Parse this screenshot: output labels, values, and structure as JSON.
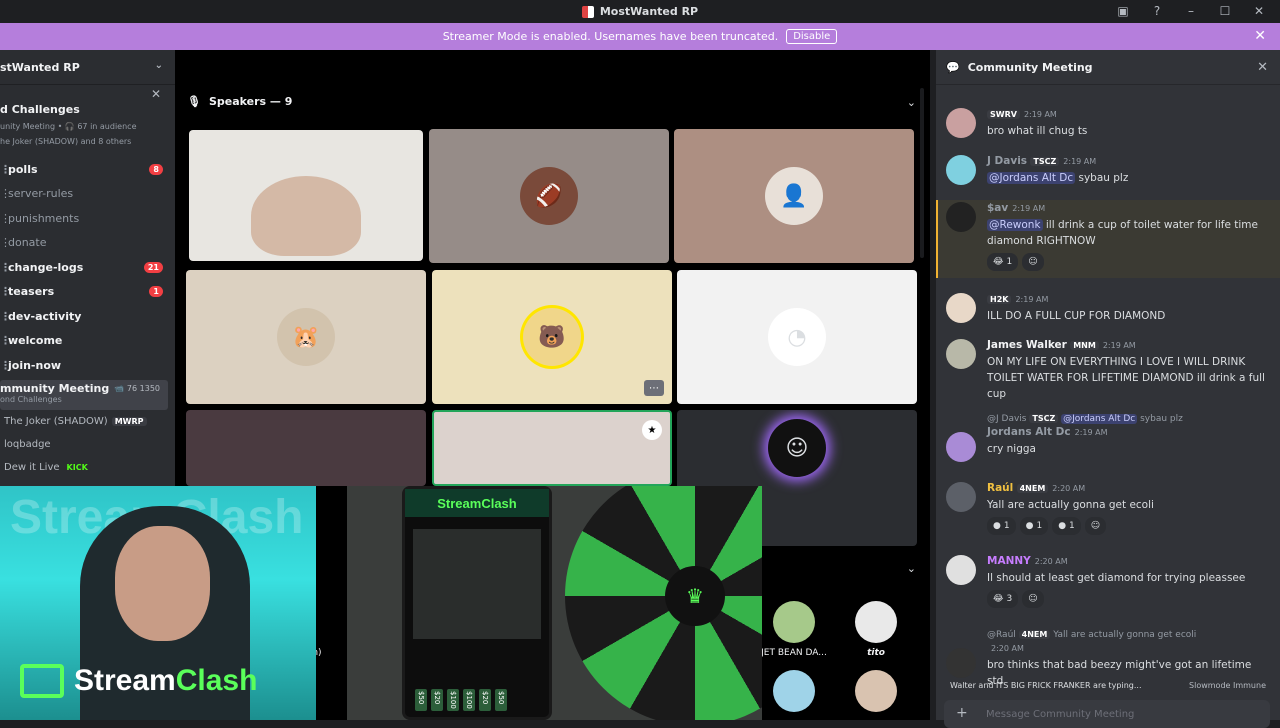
{
  "app": {
    "title": "MostWanted RP"
  },
  "banner": {
    "text": "Streamer Mode is enabled. Usernames have been truncated.",
    "button": "Disable"
  },
  "sidebar": {
    "server_name": "stWanted RP",
    "event": {
      "title": "d Challenges",
      "line1": "unity Meeting • 🎧 67 in audience",
      "line2": "he Joker (SHADOW) and 8 others"
    },
    "channels": [
      {
        "name": "polls",
        "bold": true,
        "badge": "8"
      },
      {
        "name": "server-rules",
        "bold": false,
        "badge": ""
      },
      {
        "name": "punishments",
        "bold": false,
        "badge": ""
      },
      {
        "name": "donate",
        "bold": false,
        "badge": ""
      },
      {
        "name": "change-logs",
        "bold": true,
        "badge": "21"
      },
      {
        "name": "teasers",
        "bold": true,
        "badge": "1"
      },
      {
        "name": "dev-activity",
        "bold": true,
        "badge": ""
      },
      {
        "name": "welcome",
        "bold": true,
        "badge": ""
      },
      {
        "name": "join-now",
        "bold": true,
        "badge": ""
      }
    ],
    "voice": {
      "name": "mmunity Meeting",
      "sub": "ond Challenges",
      "count": "76",
      "aud": "1350"
    },
    "voice_users": [
      {
        "name": "The Joker (SHADOW)",
        "tag": "MWRP"
      },
      {
        "name": "loqbadge",
        "tag": ""
      },
      {
        "name": "Dew it Live",
        "tag": "KICK"
      }
    ]
  },
  "stage": {
    "speakers_label": "Speakers — 9",
    "audience": [
      {
        "name": "Twin)"
      },
      {
        "name": "JET BEAN DA..."
      },
      {
        "name": "tito"
      }
    ]
  },
  "overlay": {
    "brand1": "Stream",
    "brand2": "Clash",
    "wm": "StreamClash",
    "phone_head": "StreamClash",
    "prices": [
      "$50",
      "$20",
      "$100",
      "$100",
      "$20",
      "$50"
    ]
  },
  "chat": {
    "header": "Community Meeting",
    "messages": [
      {
        "name": "",
        "tag": "SWRV",
        "time": "2:19 AM",
        "text": "bro what ill chug ts",
        "color": "#e060b0"
      },
      {
        "name": "J Davis",
        "tag": "TSCZ",
        "time": "2:19 AM",
        "mention": "@Jordans Alt Dc",
        "text": " sybau plz",
        "color": "#949ba4"
      },
      {
        "name": "$av",
        "tag": "",
        "time": "2:19 AM",
        "mention": "@Rewonk",
        "text": " ill drink a cup of toilet water for life time diamond RIGHTNOW",
        "color": "#949ba4",
        "react": "1"
      },
      {
        "name": "",
        "tag": "H2K",
        "time": "2:19 AM",
        "text": "ILL DO A FULL CUP FOR DIAMOND",
        "color": "#e060b0"
      },
      {
        "name": "James Walker",
        "tag": "MNM",
        "time": "2:19 AM",
        "text": "ON MY LIFE ON EVERYTHING I LOVE I WILL DRINK TOILET WATER FOR LIFETIME DIAMOND ill drink a full cup",
        "color": "#f2f3f5"
      },
      {
        "reply_name": "@J Davis",
        "reply_tag": "TSCZ",
        "reply_mention": "@Jordans Alt Dc",
        "reply_text": " sybau plz",
        "name": "Jordans Alt Dc",
        "time": "2:19 AM",
        "text": "cry nigga",
        "color": "#949ba4"
      },
      {
        "name": "Raúl",
        "tag": "4NEM",
        "time": "2:20 AM",
        "text": "Yall are actually gonna get ecoli",
        "color": "#f0c040",
        "reacts": [
          "1",
          "1",
          "1"
        ]
      },
      {
        "name": "MANNY",
        "tag": "",
        "time": "2:20 AM",
        "text": "Il should at least get diamond for trying pleassee",
        "color": "#c77dff",
        "react": "3"
      },
      {
        "reply_name": "@Raúl",
        "reply_tag": "4NEM",
        "reply_text": " Yall are actually gonna get ecoli",
        "name": "",
        "time": "2:20 AM",
        "text": "bro thinks that bad beezy might've got an lifetime std",
        "color": "#e060b0"
      }
    ],
    "typing": "Walter and ITS BIG FRICK FRANKER are typing...",
    "slowmode": "Slowmode Immune",
    "placeholder": "Message Community Meeting"
  }
}
